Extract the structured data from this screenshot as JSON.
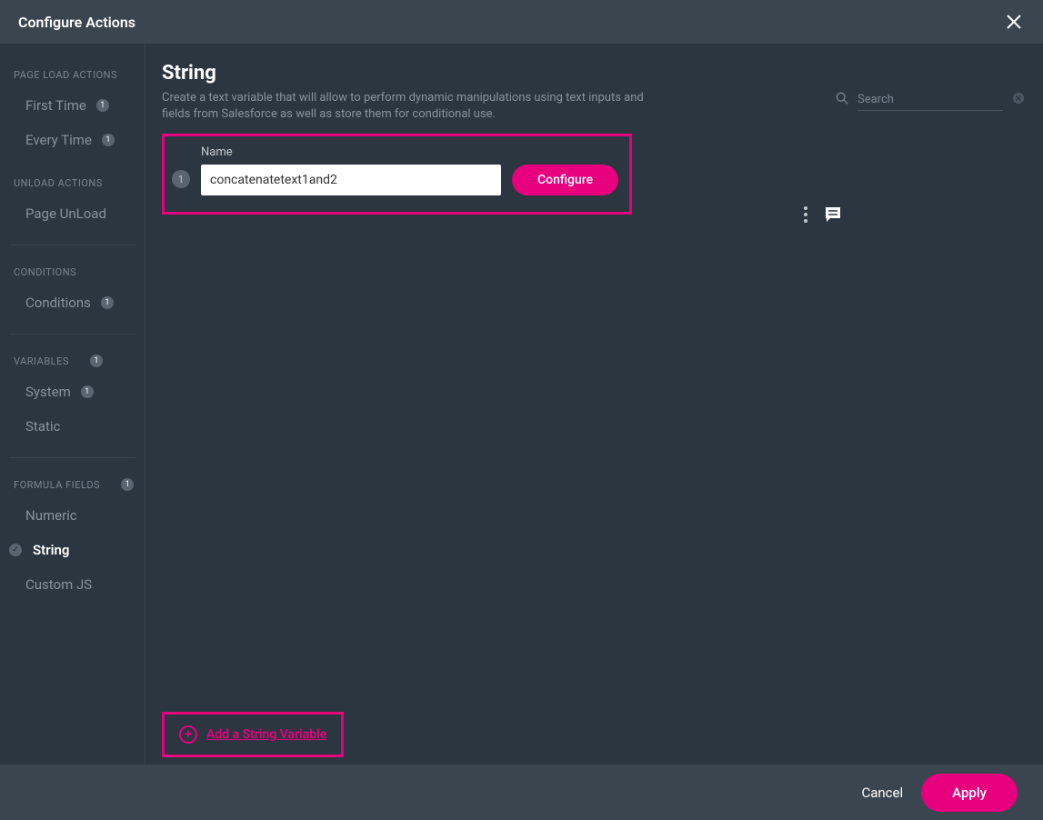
{
  "header": {
    "title": "Configure Actions"
  },
  "sidebar": {
    "sections": [
      {
        "header": "PAGE LOAD ACTIONS",
        "items": [
          {
            "label": "First Time",
            "badge": "1"
          },
          {
            "label": "Every Time",
            "badge": "1"
          }
        ]
      },
      {
        "header": "UNLOAD ACTIONS",
        "items": [
          {
            "label": "Page UnLoad"
          }
        ]
      },
      {
        "header": "CONDITIONS",
        "items": [
          {
            "label": "Conditions",
            "badge": "1"
          }
        ]
      },
      {
        "header": "VARIABLES",
        "headerBadge": "1",
        "items": [
          {
            "label": "System",
            "badge": "1"
          },
          {
            "label": "Static"
          }
        ]
      },
      {
        "header": "FORMULA FIELDS",
        "headerBadge": "1",
        "items": [
          {
            "label": "Numeric"
          },
          {
            "label": "String",
            "active": true
          },
          {
            "label": "Custom JS"
          }
        ]
      }
    ]
  },
  "main": {
    "title": "String",
    "subtitle": "Create a text variable that will allow to perform dynamic manipulations using text inputs and fields from Salesforce as well as store them for conditional use.",
    "search_placeholder": "Search",
    "card": {
      "number": "1",
      "name_label": "Name",
      "name_value": "concatenatetext1and2",
      "configure_label": "Configure"
    },
    "add_link_label": "Add a String Variable"
  },
  "footer": {
    "cancel_label": "Cancel",
    "apply_label": "Apply"
  }
}
